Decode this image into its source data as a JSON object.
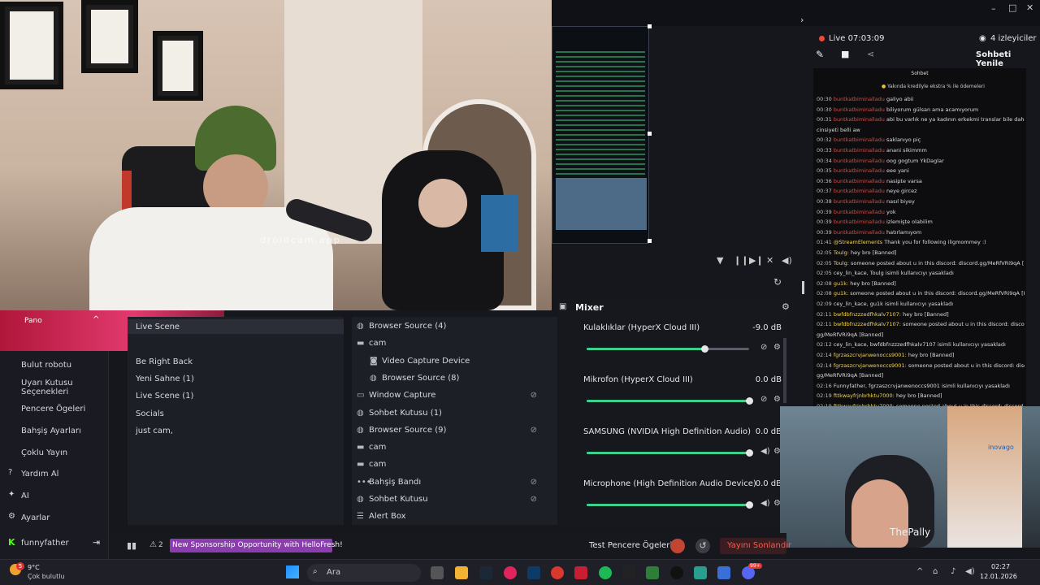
{
  "preview_watermark": "droidcam.app",
  "header": {
    "live_status": "Live 07:03:09",
    "viewers": "4 izleyiciler",
    "refresh_chat": "Sohbeti Yenile"
  },
  "chat": {
    "title": "Sohbet",
    "pinned": "Yakında kredilyle ekstra % ile ödemeleri",
    "messages": [
      {
        "time": "00:30",
        "user": "buntkatbiminalladu",
        "text": "galiyo abii"
      },
      {
        "time": "00:30",
        "user": "buntkatbiminalladu",
        "text": "biliyorum gülsan ama acamıyorum"
      },
      {
        "time": "00:31",
        "user": "buntkatbiminalladu",
        "text": "abi bu varlık ne ya kadının erkekmi translar bile daha"
      },
      {
        "time": "",
        "user": "",
        "text": "cinsiyeti belli aw"
      },
      {
        "time": "00:32",
        "user": "buntkatbiminalladu",
        "text": "saklanıyo piç"
      },
      {
        "time": "00:33",
        "user": "buntkatbiminalladu",
        "text": "anani sikimmm"
      },
      {
        "time": "00:34",
        "user": "buntkatbiminalladu",
        "text": "oog gogtum YkDaglar"
      },
      {
        "time": "00:35",
        "user": "buntkatbiminalladu",
        "text": "eee yani"
      },
      {
        "time": "00:36",
        "user": "buntkatbiminalladu",
        "text": "nasipte varsa"
      },
      {
        "time": "00:37",
        "user": "buntkatbiminalladu",
        "text": "neye gircez"
      },
      {
        "time": "00:38",
        "user": "buntkatbiminalladu",
        "text": "nasıl biyey"
      },
      {
        "time": "00:39",
        "user": "buntkatbiminalladu",
        "text": "yok"
      },
      {
        "time": "00:39",
        "user": "buntkatbiminalladu",
        "text": "izlemişte olabilim"
      },
      {
        "time": "00:39",
        "user": "buntkatbiminalladu",
        "text": "hatırlamıyom"
      },
      {
        "time": "01:41",
        "user": "@StreamElements",
        "text": "Thank you for following iligmommey :)"
      },
      {
        "time": "02:05",
        "user": "Toulg:",
        "text": "hey bro [Banned]"
      },
      {
        "time": "02:05",
        "user": "Toulg:",
        "text": "someone posted about u in this discord: discord.gg/MeRfVRi9qA [Banned]"
      },
      {
        "time": "02:05",
        "user": "",
        "text": "cey_lin_kace, Toulg isimli kullanıcıyı yasakladı"
      },
      {
        "time": "02:08",
        "user": "gu1k:",
        "text": "hey bro [Banned]"
      },
      {
        "time": "02:08",
        "user": "gu1k:",
        "text": "someone posted about u in this discord: discord.gg/MeRfVRi9qA [Banned]"
      },
      {
        "time": "02:09",
        "user": "",
        "text": "cey_lin_kace, gu1k isimli kullanıcıyı yasakladı"
      },
      {
        "time": "02:11",
        "user": "bwfdbfnzzzedfhkalv7107:",
        "text": "hey bro [Banned]"
      },
      {
        "time": "02:11",
        "user": "bwfdbfnzzzedfhkalv7107:",
        "text": "someone posted about u in this discord: discord."
      },
      {
        "time": "",
        "user": "",
        "text": "gg/MeRfVRi9qA [Banned]"
      },
      {
        "time": "02:12",
        "user": "",
        "text": "cey_lin_kace, bwfdbfnzzzedfhkalv7107 isimli kullanıcıyı yasakladı"
      },
      {
        "time": "02:14",
        "user": "fgrzaszcrvjanwenoccs9001:",
        "text": "hey bro [Banned]"
      },
      {
        "time": "02:14",
        "user": "fgrzaszcrvjanwenoccs9001:",
        "text": "someone posted about u in this discord: discord."
      },
      {
        "time": "",
        "user": "",
        "text": "gg/MeRfVRi9qA [Banned]"
      },
      {
        "time": "02:16",
        "user": "",
        "text": "Funnyfather, fgrzaszcrvjanwenoccs9001 isimli kullanıcıyı yasakladı"
      },
      {
        "time": "02:19",
        "user": "fttkwayfrjnbrhktu7000:",
        "text": "hey bro [Banned]"
      },
      {
        "time": "02:19",
        "user": "fttkwayfrjnbrhktu7000:",
        "text": "someone posted about u in this discord: discord."
      }
    ]
  },
  "nav": {
    "items": [
      "Bulut robotu",
      "Uyarı Kutusu Seçenekleri",
      "Pencere Ögeleri",
      "Bahşiş Ayarları",
      "Çoklu Yayın",
      "Yardım Al",
      "AI",
      "Ayarlar"
    ],
    "user": "funnyfather"
  },
  "scenes": {
    "items": [
      "Live Scene",
      "Be Right Back",
      "Yeni Sahne (1)",
      "Live Scene (1)",
      "Socials",
      "just cam,"
    ],
    "active_index": 0
  },
  "sources": {
    "items": [
      {
        "label": "Browser Source (4)",
        "icon": "globe-icon",
        "level": 0,
        "hidden": false
      },
      {
        "label": "cam",
        "icon": "folder-icon",
        "level": 0,
        "hidden": false
      },
      {
        "label": "Video Capture Device",
        "icon": "camera-icon",
        "level": 1,
        "hidden": false
      },
      {
        "label": "Browser Source (8)",
        "icon": "globe-icon",
        "level": 1,
        "hidden": false
      },
      {
        "label": "Window Capture",
        "icon": "window-icon",
        "level": 0,
        "hidden": true
      },
      {
        "label": "Sohbet Kutusu (1)",
        "icon": "globe-icon",
        "level": 0,
        "hidden": false
      },
      {
        "label": "Browser Source (9)",
        "icon": "globe-icon",
        "level": 0,
        "hidden": true
      },
      {
        "label": "cam",
        "icon": "folder-icon",
        "level": 0,
        "hidden": false
      },
      {
        "label": "cam",
        "icon": "folder-icon",
        "level": 0,
        "hidden": false
      },
      {
        "label": "Bahşiş Bandı",
        "icon": "dots-icon",
        "level": 0,
        "hidden": true
      },
      {
        "label": "Sohbet Kutusu",
        "icon": "globe-icon",
        "level": 0,
        "hidden": true
      },
      {
        "label": "Alert Box",
        "icon": "list-icon",
        "level": 0,
        "hidden": false
      }
    ]
  },
  "mixer": {
    "title": "Mixer",
    "channels": [
      {
        "name": "Kulaklıklar (HyperX Cloud III)",
        "db": "-9.0 dB",
        "level": 0.72
      },
      {
        "name": "Mikrofon (HyperX Cloud III)",
        "db": "0.0 dB",
        "level": 1.0
      },
      {
        "name": "SAMSUNG (NVIDIA High Definition Audio)",
        "db": "0.0 dB",
        "level": 1.0
      },
      {
        "name": "Microphone (High Definition Audio Device)",
        "db": "0.0 dB",
        "level": 1.0
      }
    ]
  },
  "bottom": {
    "alerts_count": "2",
    "sponsorship": "New Sponsorship Opportunity with HelloFresh!",
    "test_widgets": "Test Pencere Ögeleri",
    "end_stream": "Yayını Sonlandır"
  },
  "streamer_overlay": {
    "name": "ThePally",
    "brand": "inovago"
  },
  "taskbar": {
    "weather_temp": "9°C",
    "weather_desc": "Çok bulutlu",
    "weather_badge": "5",
    "search_placeholder": "Ara",
    "notification_badge": "99+",
    "time": "02:27",
    "date": "12.01.2026"
  },
  "colors": {
    "accent_green": "#3ecf8e",
    "live_red": "#e94b3c",
    "purple_banner": "#8b3db0"
  }
}
